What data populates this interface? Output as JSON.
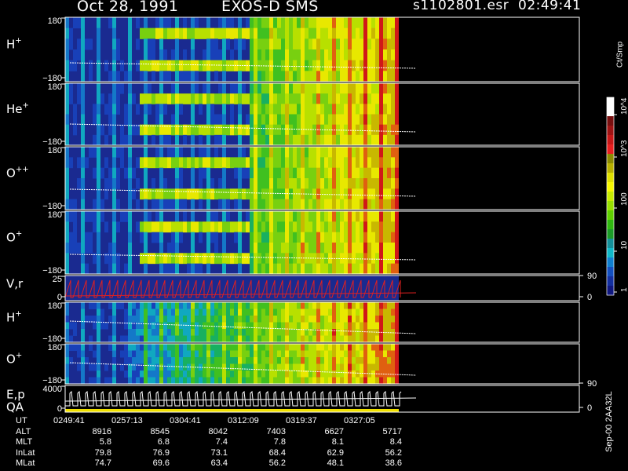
{
  "header": {
    "date": "Oct 28, 1991",
    "instrument": "EXOS-D SMS",
    "file": "s1102801.esr",
    "time": "02:49:41"
  },
  "footer_label": "Sep-00 2AA32L",
  "colors": {
    "background": "#000000",
    "panel_bg": "#1a2a90",
    "trace": "#ffffff",
    "velocity_trace": "#e02020",
    "qa_bar": "#f0e000"
  },
  "chart_data": {
    "type": "heatmap",
    "colorbar": {
      "title": "Ct/Smp",
      "scale": "log",
      "ticks": [
        "1",
        "10",
        "100",
        "10^3",
        "10^4"
      ],
      "range": [
        1,
        10000
      ]
    },
    "time_axis": {
      "label": "UT",
      "ticks": [
        "0249:41",
        "0257:13",
        "0304:41",
        "0312:09",
        "0319:37",
        "0327:05"
      ]
    },
    "panels": [
      {
        "label": "H",
        "superscript": "+",
        "ylabels": [
          "180",
          "−180"
        ]
      },
      {
        "label": "He",
        "superscript": "+",
        "ylabels": [
          "180",
          "−180"
        ]
      },
      {
        "label": "O",
        "superscript": "++",
        "ylabels": [
          "180",
          "−180"
        ]
      },
      {
        "label": "O",
        "superscript": "+",
        "ylabels": [
          "180",
          "−180"
        ]
      },
      {
        "label": "V,r",
        "superscript": "",
        "ylabels": [
          "25",
          "0"
        ],
        "right_labels": [
          "90",
          "0"
        ]
      },
      {
        "label": "H",
        "superscript": "+",
        "ylabels": [
          "180",
          "−180"
        ]
      },
      {
        "label": "O",
        "superscript": "+",
        "ylabels": [
          "180",
          "−180"
        ],
        "right_labels": [
          "90"
        ]
      },
      {
        "label": "E,p",
        "label2": "QA",
        "superscript": "",
        "ylabels": [
          "4000",
          "0"
        ],
        "right_labels": [
          "0"
        ]
      }
    ],
    "ephemeris": [
      {
        "name": "UT",
        "values": [
          "0249:41",
          "0257:13",
          "0304:41",
          "0312:09",
          "0319:37",
          "0327:05"
        ]
      },
      {
        "name": "ALT",
        "values": [
          "8916",
          "8545",
          "8042",
          "7403",
          "6627",
          "5717"
        ]
      },
      {
        "name": "MLT",
        "values": [
          "5.8",
          "6.8",
          "7.4",
          "7.8",
          "8.1",
          "8.4"
        ]
      },
      {
        "name": "InLat",
        "values": [
          "79.8",
          "76.9",
          "73.1",
          "68.4",
          "62.9",
          "56.2"
        ]
      },
      {
        "name": "MLat",
        "values": [
          "74.7",
          "69.6",
          "63.4",
          "56.2",
          "48.1",
          "38.6"
        ]
      }
    ]
  }
}
